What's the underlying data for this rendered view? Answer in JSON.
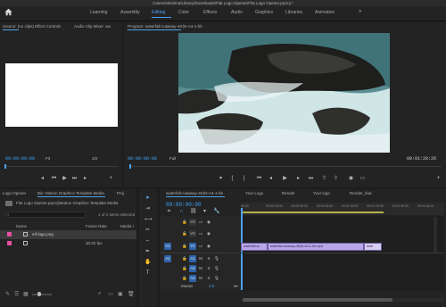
{
  "window_title": "/Users/skrishna/Library/Downloads/Flat Logo Opener/Flat Logo Opener.prproj *",
  "workspaces": [
    {
      "label": "Learning",
      "active": false
    },
    {
      "label": "Assembly",
      "active": false
    },
    {
      "label": "Editing",
      "active": true
    },
    {
      "label": "Color",
      "active": false
    },
    {
      "label": "Effects",
      "active": false
    },
    {
      "label": "Audio",
      "active": false
    },
    {
      "label": "Graphics",
      "active": false
    },
    {
      "label": "Libraries",
      "active": false
    },
    {
      "label": "Animation",
      "active": false
    }
  ],
  "more_label": "»",
  "source_panel": {
    "tabs": [
      "Source: (no clips)",
      "Effect Controls",
      "Audio Clip Mixer: wa"
    ],
    "timecode": "00:00:00:00",
    "fit": "Fit",
    "resolution": "1/2"
  },
  "program_panel": {
    "title": "Program: waterfall-cutaway-4K(N-A4-1-hb",
    "timecode_left": "00:00:00:00",
    "fit": "Full",
    "timecode_right": "00:01:20:26"
  },
  "project_panel": {
    "tabs": [
      "Logo Opener",
      "Bin: Motion Graphics Template Media",
      "Proj"
    ],
    "path": "Flat Logo Opener.prproj\\Motion Graphics Template Media",
    "search_placeholder": "",
    "selection_info": "1 of 2 items selected",
    "columns": [
      "Name",
      "Frame Rate",
      "Media I"
    ],
    "items": [
      {
        "name": "mf-logo.png",
        "frame_rate": "",
        "color": "#e44fa3"
      },
      {
        "name": "",
        "frame_rate": "30.00 fps",
        "color": "#e44fa3"
      }
    ]
  },
  "timeline_panel": {
    "tabs": [
      "waterfall-cutaway-4K(N-A4-1-hb",
      "Your Logo",
      "Render",
      "Your logo",
      "Render_fnal"
    ],
    "timecode": "00:00:00:00",
    "ruler": [
      "00:00",
      "00:00:15:00",
      "00:00:30:00",
      "00:00:45:00",
      "00:01:00:00",
      "00:01:15:00",
      "00:01:30:00",
      "00:01:45:00"
    ],
    "video_tracks": [
      "V3",
      "V2",
      "V1"
    ],
    "audio_tracks": [
      "A1",
      "A2",
      "A3"
    ],
    "master_label": "Master",
    "master_value": "0.0",
    "clips": [
      "waterfall-cu",
      "waterfall-cutaway-4K(N-A4-1-hb.mp4",
      "bela"
    ]
  },
  "accent_color": "#4aa2f1"
}
